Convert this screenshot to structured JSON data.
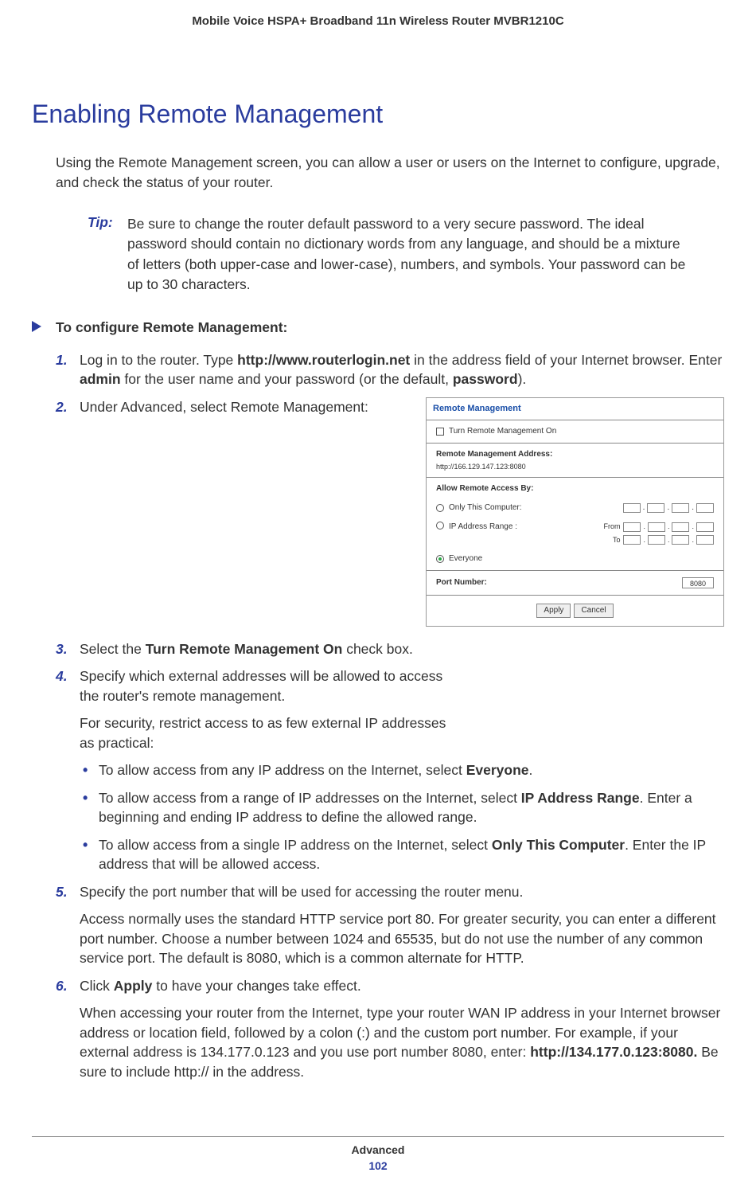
{
  "running_header": "Mobile Voice HSPA+ Broadband 11n Wireless Router MVBR1210C",
  "heading": "Enabling Remote Management",
  "intro": "Using the Remote Management screen, you can allow a user or users on the Internet to configure, upgrade, and check the status of your router.",
  "tip_label": "Tip:",
  "tip_text": "Be sure to change the router default password to a very secure password. The ideal password should contain no dictionary words from any language, and should be a mixture of letters (both upper-case and lower-case), numbers, and symbols. Your password can be up to 30 characters.",
  "proc_title": "To configure Remote Management:",
  "steps": {
    "s1_a": "Log in to the router. Type ",
    "s1_b": "http://www.routerlogin.net",
    "s1_c": " in the address field of your Internet browser. Enter ",
    "s1_d": "admin",
    "s1_e": " for the user name and your password (or the default, ",
    "s1_f": "password",
    "s1_g": ").",
    "s2": "Under Advanced, select Remote Management:",
    "s3_a": "Select the ",
    "s3_b": "Turn Remote Management On",
    "s3_c": " check box.",
    "s4": "Specify which external addresses will be allowed to access the router's remote management.",
    "s4_note": "For security, restrict access to as few external IP addresses as practical:",
    "b1_a": "To allow access from any IP address on the Internet, select ",
    "b1_b": "Everyone",
    "b1_c": ".",
    "b2_a": "To allow access from a range of IP addresses on the Internet, select ",
    "b2_b": "IP Address Range",
    "b2_c": ". Enter a beginning and ending IP address to define the allowed range.",
    "b3_a": "To allow access from a single IP address on the Internet, select ",
    "b3_b": "Only This Computer",
    "b3_c": ". Enter the IP address that will be allowed access.",
    "s5": "Specify the port number that will be used for accessing the router menu.",
    "s5_note": "Access normally uses the standard HTTP service port 80. For greater security, you can enter a different port number. Choose a number between 1024 and 65535, but do not use the number of any common service port. The default is 8080, which is a common alternate for HTTP.",
    "s6_a": "Click ",
    "s6_b": "Apply",
    "s6_c": " to have your changes take effect.",
    "s6_note_a": "When accessing your router from the Internet, type your router WAN IP address in your Internet browser address or location field, followed by a colon (:) and the custom port number. For example, if your external address is 134.177.0.123 and you use port number 8080, enter: ",
    "s6_note_b": "http://134.177.0.123:8080.",
    "s6_note_c": " Be sure to include http:// in the address."
  },
  "screenshot": {
    "title": "Remote Management",
    "checkbox_label": "Turn Remote Management On",
    "addr_label": "Remote Management Address:",
    "addr_value": "http://166.129.147.123:8080",
    "allow_label": "Allow Remote Access By:",
    "opt_only": "Only This Computer:",
    "opt_range": "IP Address Range :",
    "from": "From",
    "to": "To",
    "opt_everyone": "Everyone",
    "port_label": "Port Number:",
    "port_value": "8080",
    "btn_apply": "Apply",
    "btn_cancel": "Cancel"
  },
  "footer_label": "Advanced",
  "footer_page": "102"
}
